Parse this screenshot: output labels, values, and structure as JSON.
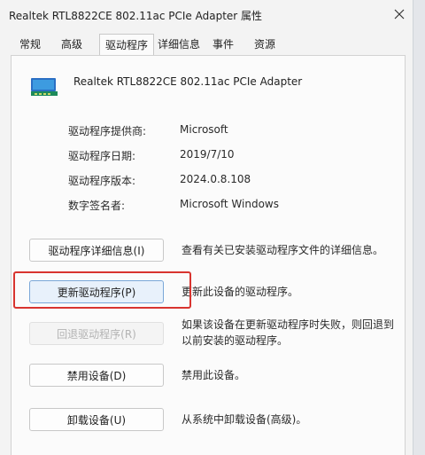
{
  "window": {
    "title": "Realtek RTL8822CE 802.11ac PCIe Adapter 属性"
  },
  "tabs": [
    {
      "label": "常规",
      "active": false
    },
    {
      "label": "高级",
      "active": false
    },
    {
      "label": "驱动程序",
      "active": true
    },
    {
      "label": "详细信息",
      "active": false
    },
    {
      "label": "事件",
      "active": false
    },
    {
      "label": "资源",
      "active": false
    }
  ],
  "device": {
    "name": "Realtek RTL8822CE 802.11ac PCIe Adapter",
    "icon": "network-adapter-icon"
  },
  "properties": [
    {
      "label": "驱动程序提供商:",
      "value": "Microsoft"
    },
    {
      "label": "驱动程序日期:",
      "value": "2019/7/10"
    },
    {
      "label": "驱动程序版本:",
      "value": "2024.0.8.108"
    },
    {
      "label": "数字签名者:",
      "value": "Microsoft Windows"
    }
  ],
  "actions": [
    {
      "label": "驱动程序详细信息(I)",
      "description": "查看有关已安装驱动程序文件的详细信息。",
      "enabled": true
    },
    {
      "label": "更新驱动程序(P)",
      "description": "更新此设备的驱动程序。",
      "enabled": true,
      "highlighted": true
    },
    {
      "label": "回退驱动程序(R)",
      "description": "如果该设备在更新驱动程序时失败，则回退到以前安装的驱动程序。",
      "enabled": false
    },
    {
      "label": "禁用设备(D)",
      "description": "禁用此设备。",
      "enabled": true
    },
    {
      "label": "卸载设备(U)",
      "description": "从系统中卸载设备(高级)。",
      "enabled": true
    }
  ],
  "colors": {
    "highlight": "#d8342f",
    "focused_button": "#e8f1fb"
  }
}
